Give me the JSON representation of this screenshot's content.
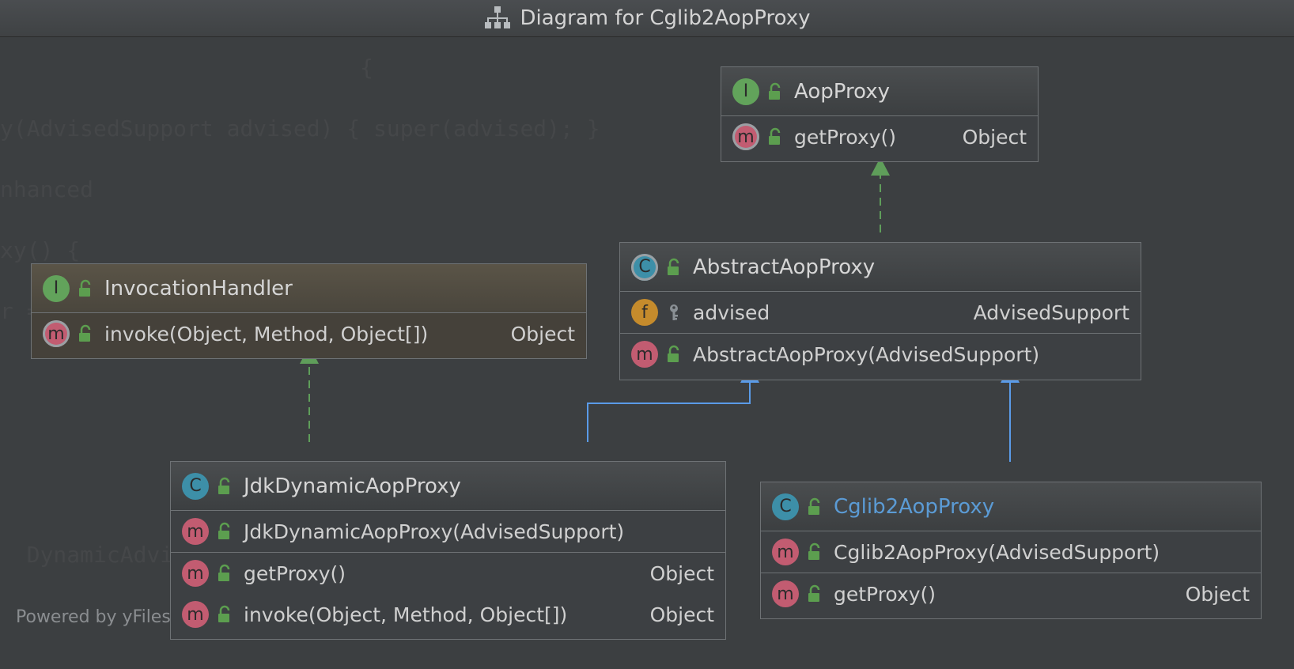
{
  "window": {
    "title": "Diagram for Cglib2AopProxy",
    "title_icon": "hierarchy-icon"
  },
  "footer": {
    "text": "Powered by yFiles"
  },
  "background_code": [
    "                           {",
    "y(AdvisedSupport advised) { super(advised); }",
    "nhanced",
    "xy() {",
    "r = new Enhancer();",
    "",
    "",
    "",
    "  DynamicAdvis"
  ],
  "colors": {
    "background": "#3c3f41",
    "border": "#6e7275",
    "interface_badge": "#62a35b",
    "method_badge": "#c25c71",
    "class_badge": "#3d8fa8",
    "field_badge": "#c58b2c",
    "implements_edge": "#5f9e5a",
    "extends_edge": "#5a9be8",
    "selected_text": "#5b9bd5"
  },
  "nodes": {
    "aop_proxy": {
      "kind": "interface",
      "badge": "I",
      "name": "AopProxy",
      "sections": [
        [
          {
            "badge": "m",
            "label": "getProxy()",
            "type": "Object",
            "abstract": true
          }
        ]
      ]
    },
    "abstract_aop_proxy": {
      "kind": "abstract-class",
      "badge": "C",
      "name": "AbstractAopProxy",
      "sections": [
        [
          {
            "badge": "f",
            "label": "advised",
            "type": "AdvisedSupport",
            "visibility": "protected"
          }
        ],
        [
          {
            "badge": "m",
            "label": "AbstractAopProxy(AdvisedSupport)",
            "type": ""
          }
        ]
      ]
    },
    "invocation_handler": {
      "kind": "interface",
      "badge": "I",
      "name": "InvocationHandler",
      "sections": [
        [
          {
            "badge": "m",
            "label": "invoke(Object, Method, Object[])",
            "type": "Object",
            "abstract": true
          }
        ]
      ]
    },
    "jdk_dynamic_aop_proxy": {
      "kind": "class",
      "badge": "C",
      "name": "JdkDynamicAopProxy",
      "sections": [
        [
          {
            "badge": "m",
            "label": "JdkDynamicAopProxy(AdvisedSupport)",
            "type": ""
          }
        ],
        [
          {
            "badge": "m",
            "label": "getProxy()",
            "type": "Object"
          },
          {
            "badge": "m",
            "label": "invoke(Object, Method, Object[])",
            "type": "Object"
          }
        ]
      ]
    },
    "cglib2_aop_proxy": {
      "kind": "class",
      "badge": "C",
      "name": "Cglib2AopProxy",
      "selected": true,
      "sections": [
        [
          {
            "badge": "m",
            "label": "Cglib2AopProxy(AdvisedSupport)",
            "type": ""
          }
        ],
        [
          {
            "badge": "m",
            "label": "getProxy()",
            "type": "Object"
          }
        ]
      ]
    }
  }
}
